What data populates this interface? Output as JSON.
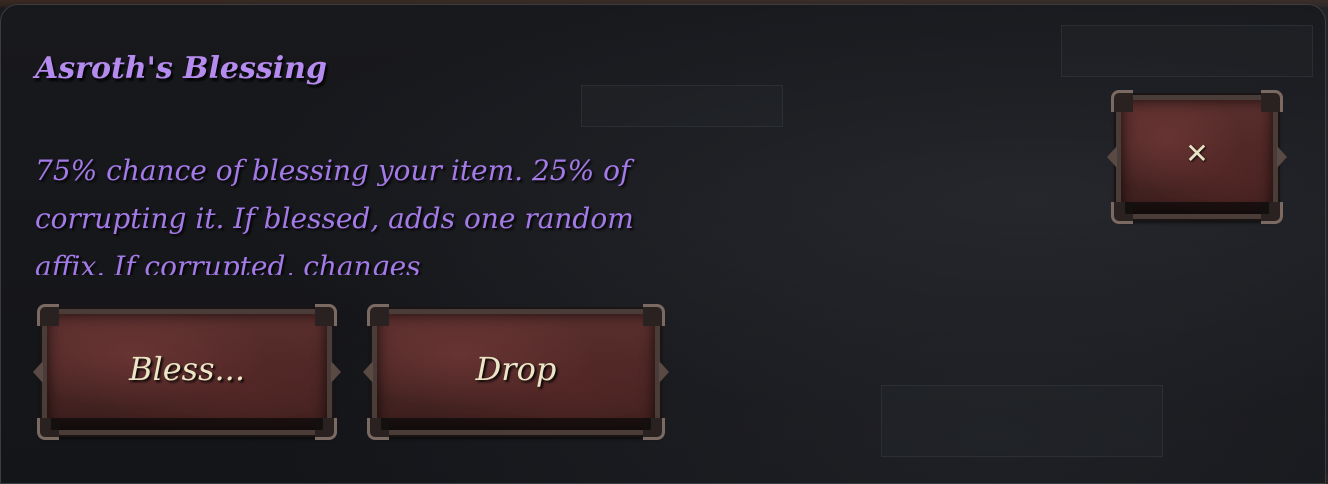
{
  "dialog": {
    "title": "Asroth's Blessing",
    "description": "75% chance of blessing your item. 25% of corrupting it. If blessed, adds one random affix. If corrupted, changes"
  },
  "buttons": {
    "bless_label": "Bless...",
    "drop_label": "Drop"
  },
  "close_button": {
    "icon": "x-icon",
    "glyph": "✕"
  },
  "colors": {
    "title": "#b68bf0",
    "description": "#a47ae8",
    "button_label": "#ece6c6",
    "panel_background": "#16171b",
    "button_fill": "#4a2624"
  }
}
